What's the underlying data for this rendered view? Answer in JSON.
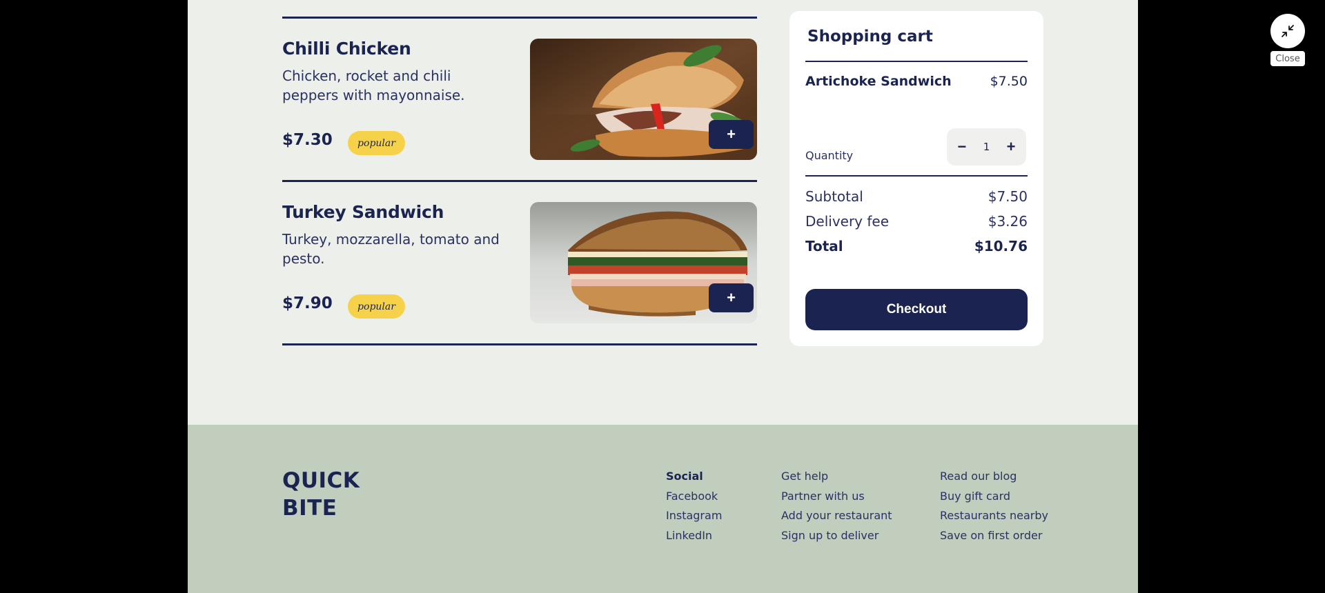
{
  "menu": {
    "items": [
      {
        "title": "Chilli Chicken",
        "description": "Chicken, rocket and chili peppers with mayonnaise.",
        "price": "$7.30",
        "badge": "popular",
        "add_label": "+"
      },
      {
        "title": "Turkey Sandwich",
        "description": "Turkey, mozzarella, tomato and pesto.",
        "price": "$7.90",
        "badge": "popular",
        "add_label": "+"
      }
    ]
  },
  "cart": {
    "title": "Shopping cart",
    "item_name": "Artichoke Sandwich",
    "item_price": "$7.50",
    "quantity_label": "Quantity",
    "quantity_value": "1",
    "minus_label": "−",
    "plus_label": "+",
    "subtotal_label": "Subtotal",
    "subtotal_value": "$7.50",
    "delivery_label": "Delivery fee",
    "delivery_value": "$3.26",
    "total_label": "Total",
    "total_value": "$10.76",
    "checkout_label": "Checkout"
  },
  "footer": {
    "logo_line1": "QUICK",
    "logo_line2": "BITE",
    "social": {
      "heading": "Social",
      "links": [
        "Facebook",
        "Instagram",
        "LinkedIn"
      ]
    },
    "help_links": [
      "Get help",
      "Partner with us",
      "Add your restaurant",
      "Sign up to deliver"
    ],
    "more_links": [
      "Read our blog",
      "Buy gift card",
      "Restaurants nearby",
      "Save on first order"
    ]
  },
  "overlay": {
    "close_label": "Close",
    "close_icon": "minimize-arrows-icon"
  },
  "colors": {
    "navy": "#1b2451",
    "badge": "#f6d24a",
    "page_bg": "#edefea",
    "footer_bg": "#c1cdbd"
  }
}
